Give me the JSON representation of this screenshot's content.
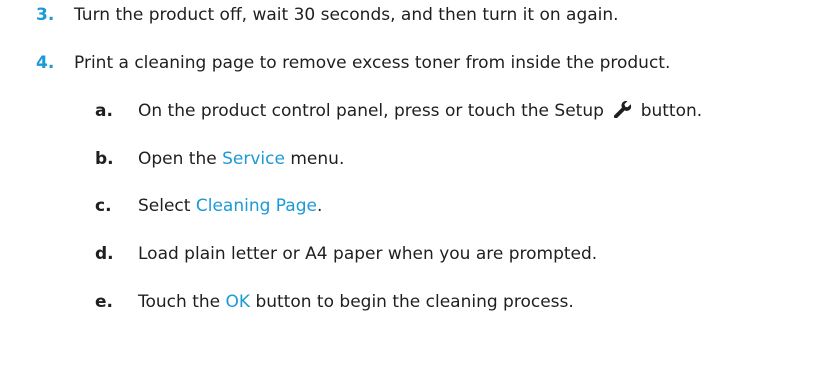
{
  "steps": [
    {
      "number": "3.",
      "text": "Turn the product off, wait 30 seconds, and then turn it on again."
    },
    {
      "number": "4.",
      "text": "Print a cleaning page to remove excess toner from inside the product."
    }
  ],
  "substeps": {
    "a": {
      "letter": "a.",
      "before": "On the product control panel, press or touch the Setup",
      "icon": "wrench-icon",
      "after": "button."
    },
    "b": {
      "letter": "b.",
      "before": "Open the",
      "link": "Service",
      "after": "menu."
    },
    "c": {
      "letter": "c.",
      "before": "Select",
      "link": "Cleaning Page",
      "after": "."
    },
    "d": {
      "letter": "d.",
      "text": "Load plain letter or A4 paper when you are prompted."
    },
    "e": {
      "letter": "e.",
      "before": "Touch the",
      "link": "OK",
      "after": "button to begin the cleaning process."
    }
  },
  "colors": {
    "accent": "#1a9ad6",
    "text": "#1f1f1f"
  }
}
